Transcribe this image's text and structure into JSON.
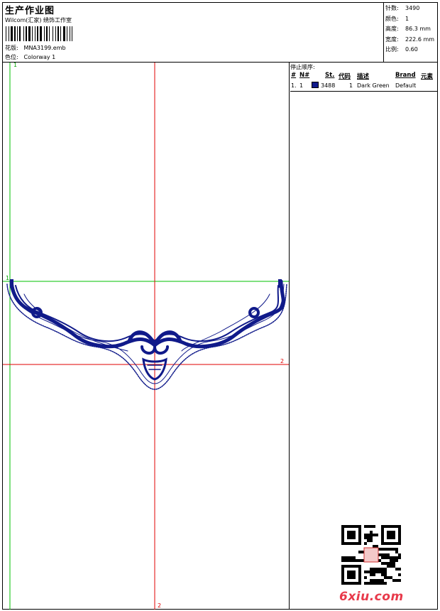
{
  "header": {
    "title": "生产作业图",
    "subtitle": "Wilcom(汇家) 绣饰工作室",
    "design_label": "花版:",
    "design_value": "MNA3199.emb",
    "colorway_label": "色位:",
    "colorway_value": "Colorway 1"
  },
  "stats": [
    {
      "label": "针数:",
      "value": "3490"
    },
    {
      "label": "颜色:",
      "value": "1"
    },
    {
      "label": "高度:",
      "value": "86.3 mm"
    },
    {
      "label": "宽度:",
      "value": "222.6 mm"
    },
    {
      "label": "比例:",
      "value": "0.60"
    }
  ],
  "sequence": {
    "title": "停止顺序:",
    "headers": {
      "num": "#",
      "n": "N#",
      "st": "St.",
      "code": "代码",
      "desc": "描述",
      "brand": "Brand",
      "element": "元素"
    },
    "rows": [
      {
        "num": "1.",
        "n": "1",
        "color": "#101a8a",
        "code": "3488",
        "st": "1",
        "desc": "Dark Green",
        "brand": "Default"
      }
    ]
  },
  "guides": {
    "green_v": "1",
    "green_h": "1",
    "red_h": "2",
    "red_v": "2"
  },
  "watermark": {
    "text": "6xiu.com"
  },
  "colors": {
    "thread": "#101a8a",
    "guide_green": "#00c000",
    "guide_red": "#e00000"
  }
}
